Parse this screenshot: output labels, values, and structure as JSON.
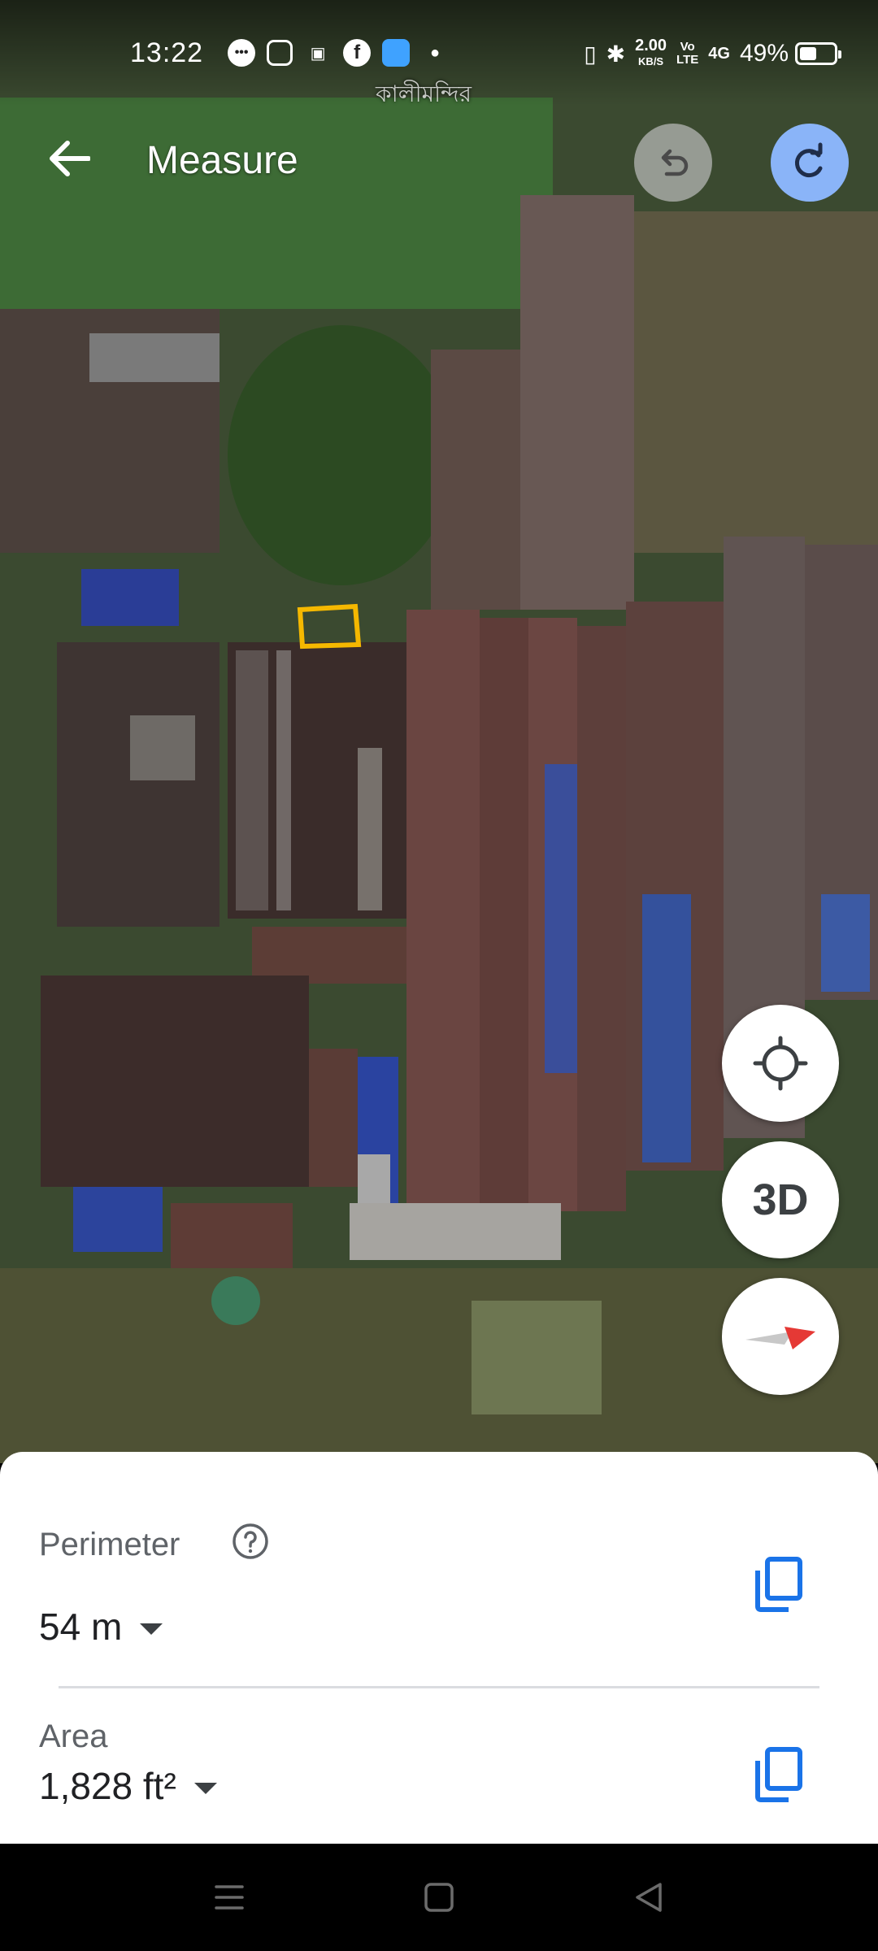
{
  "status_bar": {
    "time": "13:22",
    "net_speed_value": "2.00",
    "net_speed_unit": "KB/S",
    "volte": "Vo\nLTE",
    "signal": "4G",
    "battery_percent": "49%",
    "battery_level": 0.49
  },
  "map": {
    "place_label": "কালীমন্দির"
  },
  "header": {
    "title": "Measure",
    "back_icon": "arrow-left-icon",
    "undo_icon": "undo-icon",
    "redo_icon": "redo-icon"
  },
  "fabs": {
    "locate_icon": "my-location-icon",
    "three_d_label": "3D",
    "compass_icon": "compass-icon"
  },
  "measurements": {
    "perimeter_label": "Perimeter",
    "perimeter_value": "54 m",
    "area_label": "Area",
    "area_value": "1,828 ft²",
    "help_icon": "help-circle-icon",
    "copy_icon": "copy-icon"
  },
  "colors": {
    "accent_blue": "#1a73e8",
    "redo_button": "#8ab4f8",
    "selection_outline": "#f5b800"
  }
}
